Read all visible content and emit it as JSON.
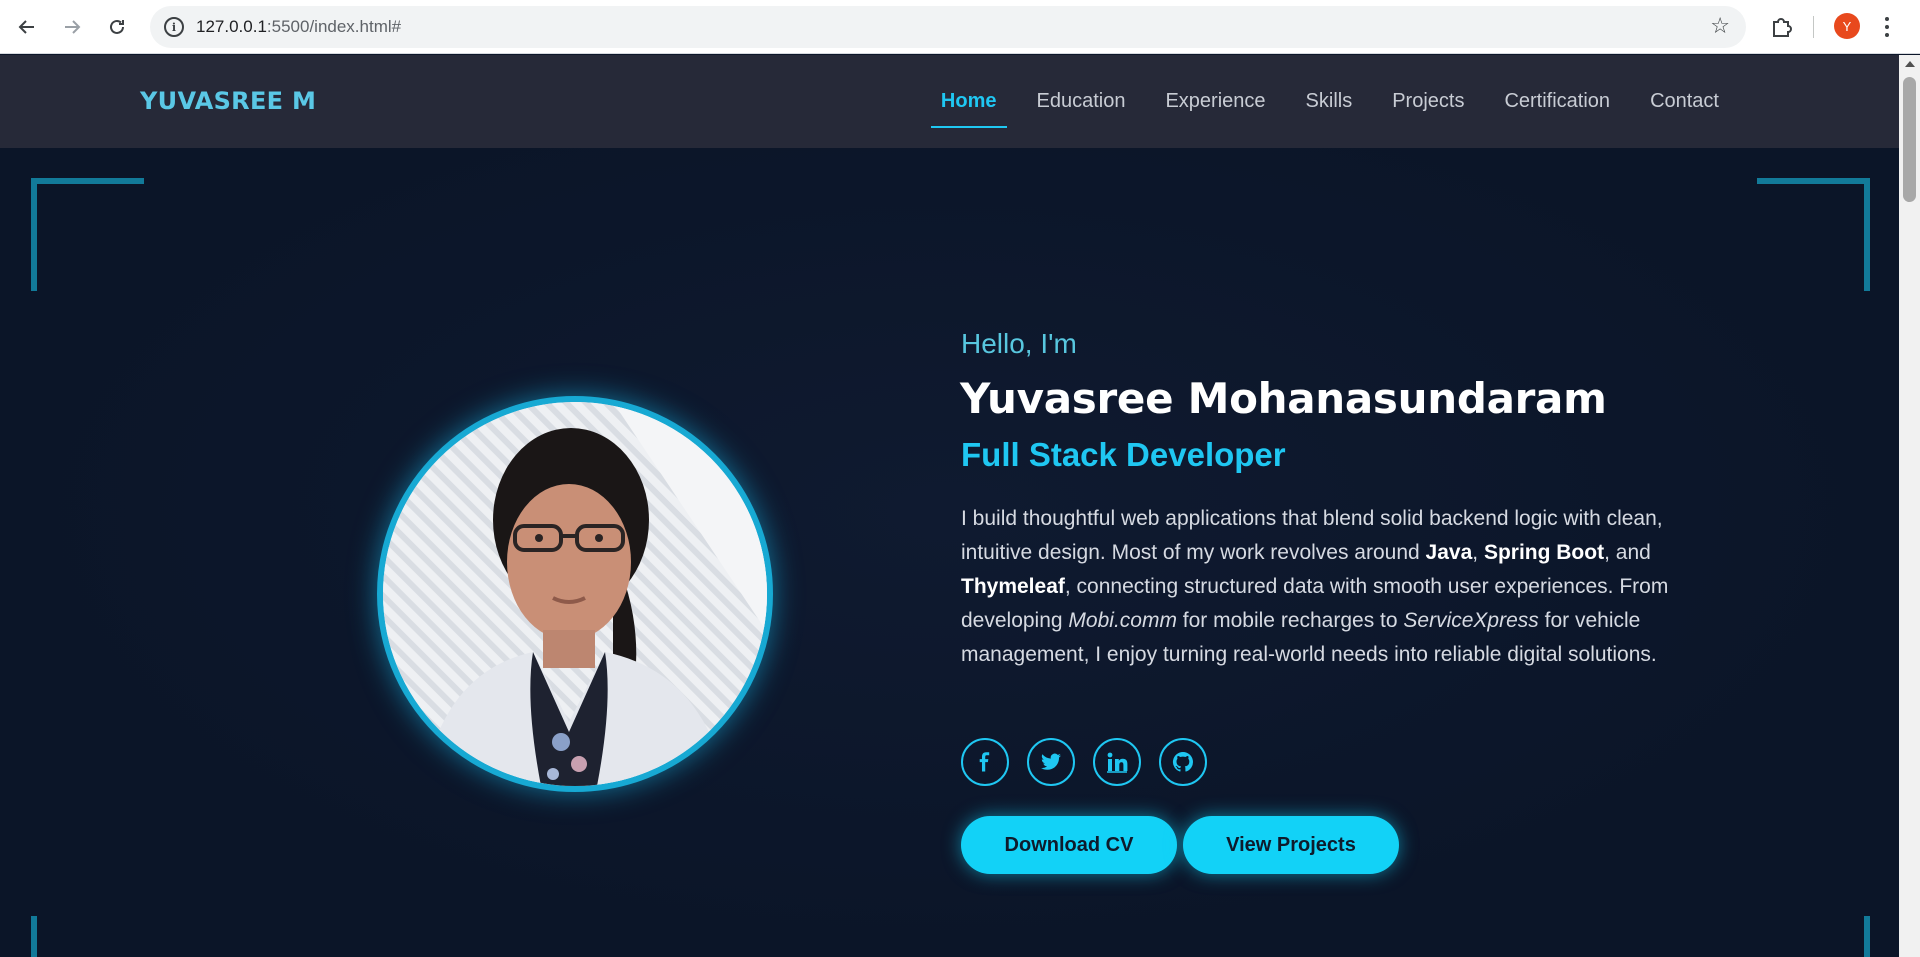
{
  "browser": {
    "url_host": "127.0.0.1",
    "url_path": ":5500/index.html#",
    "profile_initial": "Y",
    "icons": [
      "back-icon",
      "forward-icon",
      "reload-icon",
      "info-icon",
      "bookmark-star-icon",
      "extensions-icon",
      "menu-icon"
    ]
  },
  "header": {
    "brand": "YUVASREE M",
    "nav": [
      {
        "label": "Home",
        "active": true
      },
      {
        "label": "Education"
      },
      {
        "label": "Experience"
      },
      {
        "label": "Skills"
      },
      {
        "label": "Projects"
      },
      {
        "label": "Certification"
      },
      {
        "label": "Contact"
      }
    ]
  },
  "hero": {
    "greeting": "Hello, I'm",
    "name": "Yuvasree Mohanasundaram",
    "role": "Full Stack Developer",
    "bio": {
      "p1": "I build thoughtful web applications that blend solid backend logic with clean, intuitive design. Most of my work revolves around ",
      "b1": "Java",
      "p2": ", ",
      "b2": "Spring Boot",
      "p3": ", and ",
      "b3": "Thymeleaf",
      "p4": ", connecting structured data with smooth user experiences. From developing ",
      "i1": "Mobi.comm",
      "p5": " for mobile recharges to ",
      "i2": "ServiceXpress",
      "p6": " for vehicle management, I enjoy turning real-world needs into reliable digital solutions."
    },
    "socials": [
      "facebook-icon",
      "twitter-icon",
      "linkedin-icon",
      "github-icon"
    ],
    "buttons": {
      "download": "Download CV",
      "projects": "View Projects"
    }
  },
  "colors": {
    "accent": "#1fc7f2",
    "background": "#0c1629",
    "header_bg": "#262938",
    "corner": "#127a99"
  }
}
